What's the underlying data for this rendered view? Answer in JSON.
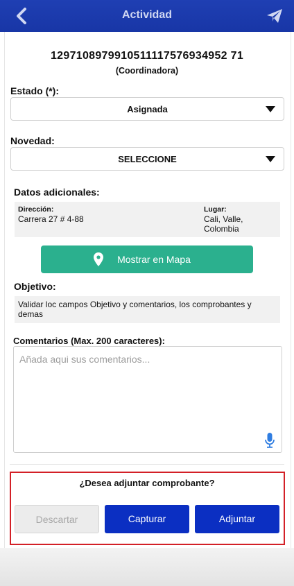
{
  "header": {
    "title": "Actividad",
    "back_icon": "chevron-left-icon",
    "send_icon": "paper-plane-icon",
    "color": "#1f3fb3"
  },
  "record": {
    "id": "1297108979910511117576934952 71",
    "role": "(Coordinadora)"
  },
  "estado": {
    "label": "Estado (*):",
    "value": "Asignada"
  },
  "novedad": {
    "label": "Novedad:",
    "value": "SELECCIONE"
  },
  "datos_adicionales": {
    "title": "Datos adicionales:",
    "direccion_label": "Dirección:",
    "direccion_value": "Carrera 27 # 4-88",
    "lugar_label": "Lugar:",
    "lugar_line1": "Cali, Valle,",
    "lugar_line2": "Colombia"
  },
  "map_button": {
    "label": "Mostrar en Mapa",
    "icon": "map-pin-icon",
    "color": "#2bb08e"
  },
  "objetivo": {
    "title": "Objetivo:",
    "text": "Validar loc campos Objetivo y comentarios, los comprobantes y demas"
  },
  "comentarios": {
    "label": "Comentarios (Max. 200 caracteres):",
    "placeholder": "Añada aqui sus comentarios...",
    "mic_icon": "microphone-icon"
  },
  "adjuntar": {
    "question": "¿Desea adjuntar comprobante?",
    "descartar": "Descartar",
    "capturar": "Capturar",
    "adjuntar": "Adjuntar",
    "highlight_color": "#d32027",
    "primary_color": "#0b2fc2"
  }
}
